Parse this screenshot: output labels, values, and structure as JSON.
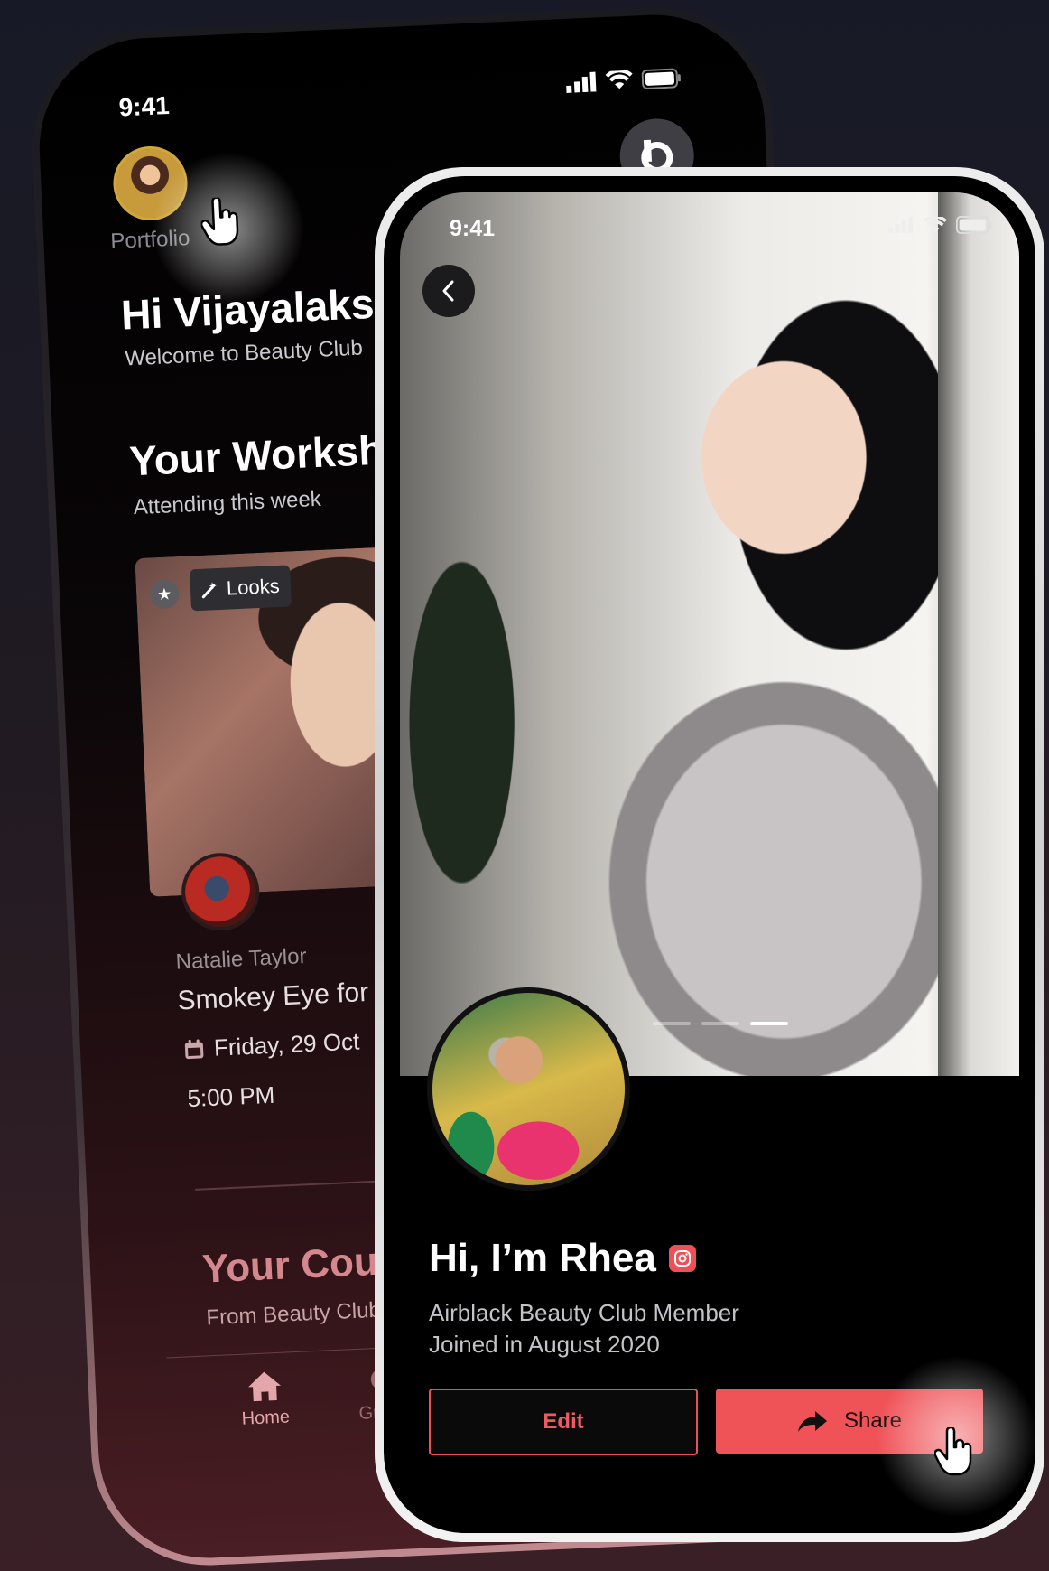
{
  "back_phone": {
    "status_time": "9:41",
    "portfolio_label": "Portfolio",
    "greeting": "Hi Vijayalaksh",
    "welcome": "Welcome to Beauty Club",
    "workshops_title": "Your Worksho",
    "workshops_sub": "Attending this week",
    "card": {
      "tag_label": "Looks",
      "host": "Natalie Taylor",
      "title": "Smokey Eye for Pa",
      "date": "Friday, 29 Oct",
      "time": "5:00 PM"
    },
    "courses_title": "Your Cours",
    "courses_sub": "From Beauty Club",
    "nav": {
      "home": "Home",
      "groups": "Groups"
    }
  },
  "front_phone": {
    "status_time": "9:41",
    "name": "Hi, I’m Rhea",
    "member": "Airblack Beauty Club Member",
    "joined": "Joined in August 2020",
    "edit_label": "Edit",
    "share_label": "Share",
    "carousel_active_index": 3,
    "carousel_count": 3
  },
  "colors": {
    "accent": "#ef5257",
    "background_top": "#171a26",
    "background_bottom": "#3a2026"
  },
  "icons": [
    "wifi-icon",
    "signal-icon",
    "battery-icon",
    "chevron-left-icon",
    "instagram-icon",
    "share-arrow-icon",
    "pointer-hand-icon",
    "star-icon",
    "wand-icon",
    "calendar-icon",
    "home-icon",
    "chat-bubble-icon",
    "brand-logo-icon"
  ]
}
